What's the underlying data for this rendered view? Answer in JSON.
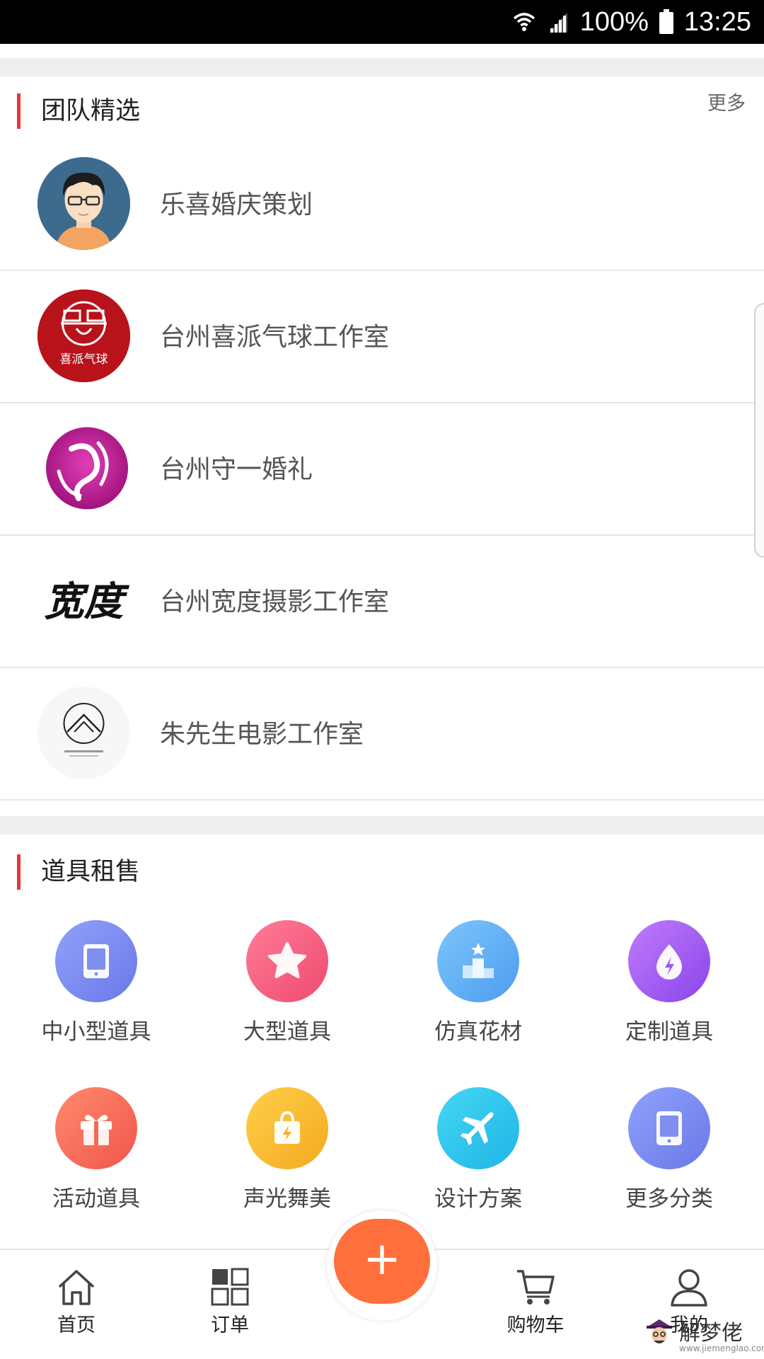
{
  "status_bar": {
    "battery": "100%",
    "time": "13:25"
  },
  "team_section": {
    "title": "团队精选",
    "more": "更多",
    "items": [
      {
        "name": "乐喜婚庆策划",
        "logo": "avatar-cartoon-man"
      },
      {
        "name": "台州喜派气球工作室",
        "logo": "xipai-logo",
        "logo_text": "喜派气球"
      },
      {
        "name": "台州守一婚礼",
        "logo": "shouyi-logo"
      },
      {
        "name": "台州宽度摄影工作室",
        "logo": "kuandu-calligraphy-logo",
        "logo_text": "宽度"
      },
      {
        "name": "朱先生电影工作室",
        "logo": "zhu-film-logo"
      }
    ]
  },
  "props_section": {
    "title": "道具租售",
    "categories": [
      {
        "label": "中小型道具",
        "icon": "tablet-icon",
        "color": "#7b8cf0"
      },
      {
        "label": "大型道具",
        "icon": "star-icon",
        "color": "#f45b7e"
      },
      {
        "label": "仿真花材",
        "icon": "podium-icon",
        "color": "#5fb1f5"
      },
      {
        "label": "定制道具",
        "icon": "bolt-drop-icon",
        "color": "#a15cf0"
      },
      {
        "label": "活动道具",
        "icon": "gift-icon",
        "color": "#f56a55"
      },
      {
        "label": "声光舞美",
        "icon": "bag-bolt-icon",
        "color": "#f5b633"
      },
      {
        "label": "设计方案",
        "icon": "plane-icon",
        "color": "#2fc6ee"
      },
      {
        "label": "更多分类",
        "icon": "tablet-icon",
        "color": "#7b8cf0"
      }
    ]
  },
  "bottom_nav": {
    "home": "首页",
    "orders": "订单",
    "add": "+",
    "cart": "购物车",
    "mine": "我的"
  },
  "watermark": {
    "text": "解梦佬",
    "url": "www.jiemenglao.com"
  },
  "colors": {
    "accent": "#e53935",
    "fab": "#ff6f3c",
    "divider": "#eeeeee"
  }
}
